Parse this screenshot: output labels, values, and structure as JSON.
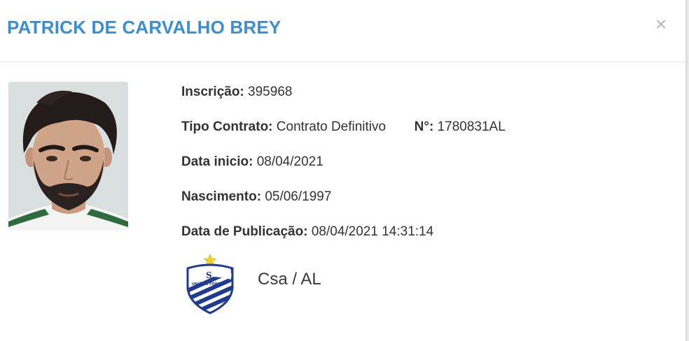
{
  "header": {
    "title": "PATRICK DE CARVALHO BREY",
    "close_label": "×"
  },
  "player": {
    "inscricao": {
      "label": "Inscrição:",
      "value": "395968"
    },
    "tipo_contrato": {
      "label": "Tipo Contrato:",
      "value": "Contrato Definitivo"
    },
    "numero": {
      "label": "N°:",
      "value": "1780831AL"
    },
    "data_inicio": {
      "label": "Data inicio:",
      "value": "08/04/2021"
    },
    "nascimento": {
      "label": "Nascimento:",
      "value": "05/06/1997"
    },
    "data_publicacao": {
      "label": "Data de Publicação:",
      "value": "08/04/2021 14:31:14"
    }
  },
  "club": {
    "name": "Csa / AL",
    "crest_icon": "csa-crest-icon",
    "crest_text": "UNIÃO E FORÇA",
    "colors": {
      "blue": "#1f3a93",
      "star": "#f2d21b"
    }
  },
  "colors": {
    "title": "#3b8fd1",
    "text": "#333333",
    "close": "#b8b8b8"
  }
}
